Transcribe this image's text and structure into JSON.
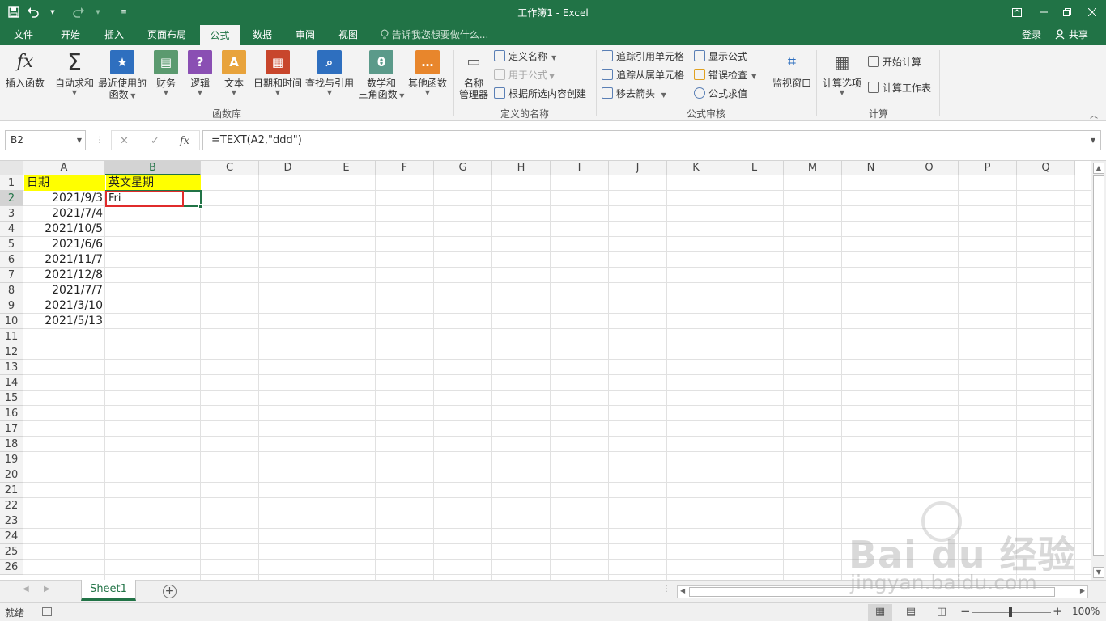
{
  "window": {
    "title": "工作簿1 - Excel",
    "qat": {
      "save_icon": "save-icon",
      "undo_icon": "undo-icon",
      "redo_icon": "redo-icon",
      "customize_icon": "customize-qat-icon"
    },
    "controls": [
      "ribbon-display-icon",
      "minimize-icon",
      "restore-icon",
      "close-icon"
    ]
  },
  "tabs": {
    "items": [
      "文件",
      "开始",
      "插入",
      "页面布局",
      "公式",
      "数据",
      "审阅",
      "视图"
    ],
    "active": "公式",
    "tell_me": "告诉我您想要做什么...",
    "login": "登录",
    "share": "共享"
  },
  "ribbon": {
    "function_library": {
      "label": "函数库",
      "insert_function": "插入函数",
      "autosum": "自动求和",
      "recent_1": "最近使用的",
      "recent_2": "函数",
      "financial": "财务",
      "logical": "逻辑",
      "text": "文本",
      "date_time": "日期和时间",
      "lookup": "查找与引用",
      "math_1": "数学和",
      "math_2": "三角函数",
      "more": "其他函数"
    },
    "defined_names": {
      "label": "定义的名称",
      "name_manager_1": "名称",
      "name_manager_2": "管理器",
      "define_name": "定义名称",
      "use_in_formula": "用于公式",
      "create_from_selection": "根据所选内容创建"
    },
    "formula_auditing": {
      "label": "公式审核",
      "trace_precedents": "追踪引用单元格",
      "trace_dependents": "追踪从属单元格",
      "remove_arrows": "移去箭头",
      "show_formulas": "显示公式",
      "error_checking": "错误检查",
      "evaluate_formula": "公式求值",
      "watch_window": "监视窗口"
    },
    "calculation": {
      "label": "计算",
      "options": "计算选项",
      "calc_now": "开始计算",
      "calc_sheet": "计算工作表"
    }
  },
  "formula_bar": {
    "name_box": "B2",
    "formula": "=TEXT(A2,\"ddd\")"
  },
  "grid": {
    "columns": [
      "A",
      "B",
      "C",
      "D",
      "E",
      "F",
      "G",
      "H",
      "I",
      "J",
      "K",
      "L",
      "M",
      "N",
      "O",
      "P",
      "Q"
    ],
    "selected_column": "B",
    "rows": [
      "1",
      "2",
      "3",
      "4",
      "5",
      "6",
      "7",
      "8",
      "9",
      "10",
      "11",
      "12",
      "13",
      "14",
      "15",
      "16",
      "17",
      "18",
      "19",
      "20",
      "21",
      "22",
      "23",
      "24",
      "25",
      "26"
    ],
    "selected_row": "2",
    "header_a": "日期",
    "header_b": "英文星期",
    "dates": [
      "2021/9/3",
      "2021/7/4",
      "2021/10/5",
      "2021/6/6",
      "2021/11/7",
      "2021/12/8",
      "2021/7/7",
      "2021/3/10",
      "2021/5/13"
    ],
    "b2_value": "Fri",
    "header_fill": "#ffff00",
    "highlight_color": "#e02b2b"
  },
  "sheets": {
    "tabs": [
      "Sheet1"
    ],
    "active": "Sheet1"
  },
  "statusbar": {
    "ready": "就绪",
    "zoom": "100%"
  },
  "watermark": {
    "brand": "Bai du 经验",
    "url": "jingyan.baidu.com"
  },
  "colors": {
    "accent": "#217346"
  }
}
